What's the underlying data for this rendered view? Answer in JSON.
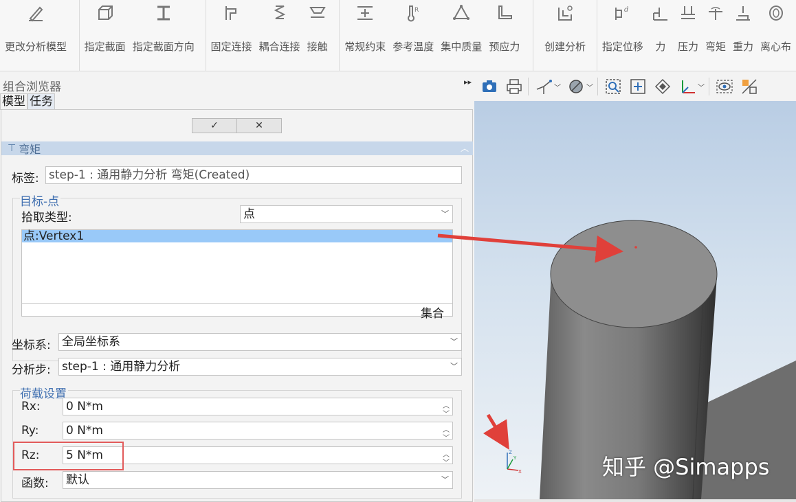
{
  "ribbon": {
    "groups": [
      {
        "buttons": [
          {
            "label": "更改分析模型",
            "icon": "edit-model-icon"
          }
        ]
      },
      {
        "buttons": [
          {
            "label": "指定截面",
            "icon": "section-icon"
          },
          {
            "label": "指定截面方向",
            "icon": "section-orientation-icon"
          }
        ]
      },
      {
        "buttons": [
          {
            "label": "固定连接",
            "icon": "fixed-connection-icon"
          },
          {
            "label": "耦合连接",
            "icon": "coupling-icon"
          },
          {
            "label": "接触",
            "icon": "contact-icon"
          }
        ]
      },
      {
        "buttons": [
          {
            "label": "常规约束",
            "icon": "constraint-icon"
          },
          {
            "label": "参考温度",
            "icon": "thermometer-icon"
          },
          {
            "label": "集中质量",
            "icon": "point-mass-icon"
          },
          {
            "label": "预应力",
            "icon": "prestress-icon"
          }
        ]
      },
      {
        "buttons": [
          {
            "label": "创建分析",
            "icon": "create-analysis-icon"
          }
        ]
      },
      {
        "buttons": [
          {
            "label": "指定位移",
            "icon": "displacement-icon"
          },
          {
            "label": "力",
            "icon": "force-icon"
          },
          {
            "label": "压力",
            "icon": "pressure-icon"
          },
          {
            "label": "弯矩",
            "icon": "moment-icon"
          },
          {
            "label": "重力",
            "icon": "gravity-icon"
          },
          {
            "label": "离心布",
            "icon": "centrifugal-icon"
          }
        ]
      }
    ]
  },
  "panel": {
    "title": "组合浏览器",
    "tabs": [
      "模型",
      "任务"
    ],
    "ok_symbol": "✓",
    "cancel_symbol": "✕",
    "section_title": "弯矩",
    "label_caption": "标签:",
    "label_value": "step-1 : 通用静力分析 弯矩(Created)",
    "target_group_title": "目标-点",
    "pick_type_caption": "拾取类型:",
    "pick_type_value": "点",
    "list_items": [
      "点:Vertex1"
    ],
    "list_footer": "集合",
    "coord_caption": "坐标系:",
    "coord_value": "全局坐标系",
    "step_caption": "分析步:",
    "step_value": "step-1 : 通用静力分析",
    "load_group_title": "荷载设置",
    "rx_caption": "Rx:",
    "rx_value": "0 N*m",
    "ry_caption": "Ry:",
    "ry_value": "0 N*m",
    "rz_caption": "Rz:",
    "rz_value": "5 N*m",
    "func_caption": "函数:",
    "func_value": "默认"
  },
  "viewport_toolbar": [
    "camera-icon",
    "print-icon",
    "axis-view-icon",
    "draw-style-icon",
    "zoom-box-icon",
    "fit-all-icon",
    "isometric-icon",
    "axis-cross-icon",
    "visibility-icon",
    "section-view-icon"
  ],
  "axis_triad": {
    "x": "X",
    "y": "Y",
    "z": "Z"
  },
  "watermark": "知乎 @Simapps",
  "colors": {
    "selection": "#99c9f8",
    "annotation_red": "#e0403a",
    "group_title": "#3f6fb0"
  }
}
